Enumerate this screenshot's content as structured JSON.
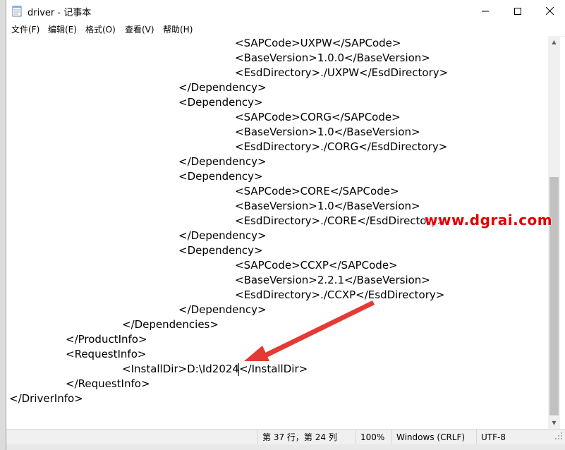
{
  "window": {
    "title": "driver - 记事本"
  },
  "menu": {
    "items": [
      "文件(F)",
      "编辑(E)",
      "格式(O)",
      "查看(V)",
      "帮助(H)"
    ]
  },
  "editor": {
    "lines": [
      "<SAPCode>UXPW</SAPCode>",
      "<BaseVersion>1.0.0</BaseVersion>",
      "<EsdDirectory>./UXPW</EsdDirectory>",
      "</Dependency>",
      "<Dependency>",
      "<SAPCode>CORG</SAPCode>",
      "<BaseVersion>1.0</BaseVersion>",
      "<EsdDirectory>./CORG</EsdDirectory>",
      "</Dependency>",
      "<Dependency>",
      "<SAPCode>CORE</SAPCode>",
      "<BaseVersion>1.0</BaseVersion>",
      "<EsdDirectory>./CORE</EsdDirectory>",
      "</Dependency>",
      "<Dependency>",
      "<SAPCode>CCXP</SAPCode>",
      "<BaseVersion>2.2.1</BaseVersion>",
      "<EsdDirectory>./CCXP</EsdDirectory>",
      "</Dependency>",
      "</Dependencies>",
      "</ProductInfo>",
      "<RequestInfo>",
      "<InstallDir>D:\\Id2024</InstallDir>",
      "</RequestInfo>",
      "</DriverInfo>"
    ]
  },
  "status": {
    "position": "第 37 行，第 24 列",
    "zoom": "100%",
    "line_ending": "Windows (CRLF)",
    "encoding": "UTF-8"
  },
  "watermark": {
    "text": "www.dgrai.com"
  },
  "colors": {
    "watermark": "#e00000",
    "arrow": "#e53935"
  }
}
